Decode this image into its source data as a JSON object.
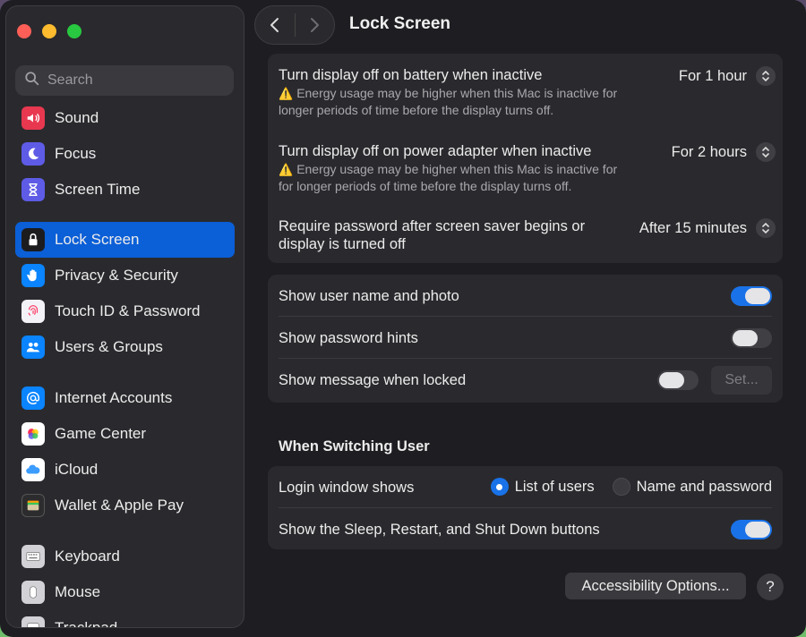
{
  "window": {
    "title": "Lock Screen"
  },
  "search": {
    "placeholder": "Search"
  },
  "sidebar": {
    "items": [
      {
        "label": "Sound",
        "icon": "speaker-icon",
        "color": "#e8384f"
      },
      {
        "label": "Focus",
        "icon": "moon-icon",
        "color": "#5e5ce6"
      },
      {
        "label": "Screen Time",
        "icon": "hourglass-icon",
        "color": "#5e5ce6"
      },
      {
        "label": "Lock Screen",
        "icon": "lock-icon",
        "color": "#1c1c1e",
        "active": true
      },
      {
        "label": "Privacy & Security",
        "icon": "hand-icon",
        "color": "#0a84ff"
      },
      {
        "label": "Touch ID & Password",
        "icon": "fingerprint-icon",
        "color": "#f2f2f7"
      },
      {
        "label": "Users & Groups",
        "icon": "users-icon",
        "color": "#0a84ff"
      },
      {
        "label": "Internet Accounts",
        "icon": "at-icon",
        "color": "#0a84ff"
      },
      {
        "label": "Game Center",
        "icon": "game-center-icon",
        "color": "#ffffff"
      },
      {
        "label": "iCloud",
        "icon": "cloud-icon",
        "color": "#ffffff"
      },
      {
        "label": "Wallet & Apple Pay",
        "icon": "wallet-icon",
        "color": "#2c2c2e"
      },
      {
        "label": "Keyboard",
        "icon": "keyboard-icon",
        "color": "#d1d1d6"
      },
      {
        "label": "Mouse",
        "icon": "mouse-icon",
        "color": "#d1d1d6"
      },
      {
        "label": "Trackpad",
        "icon": "trackpad-icon",
        "color": "#d1d1d6"
      }
    ]
  },
  "display": {
    "battery": {
      "title": "Turn display off on battery when inactive",
      "warning": "Energy usage may be higher when this Mac is inactive for",
      "warning2": "longer periods of time before the display turns off.",
      "value": "For 1 hour"
    },
    "adapter": {
      "title": "Turn display off on power adapter when inactive",
      "warning": "Energy usage may be higher when this Mac is inactive for",
      "warning2": "for longer periods of time before the display turns off.",
      "value": "For 2 hours"
    },
    "password": {
      "title": "Require password after screen saver begins or",
      "title2": "display is turned off",
      "value": "After 15 minutes"
    }
  },
  "options": {
    "show_user": {
      "label": "Show user name and photo",
      "on": true
    },
    "show_hints": {
      "label": "Show password hints",
      "on": false
    },
    "show_message": {
      "label": "Show message when locked",
      "on": false,
      "button": "Set..."
    }
  },
  "switching": {
    "header": "When Switching User",
    "login_label": "Login window shows",
    "radio_list": "List of users",
    "radio_name": "Name and password",
    "selected": "List of users",
    "sleep_label": "Show the Sleep, Restart, and Shut Down buttons",
    "sleep_on": true
  },
  "footer": {
    "accessibility": "Accessibility Options...",
    "help": "?"
  },
  "colors": {
    "accent": "#1a72e8",
    "active_sidebar": "#0b5fd7"
  }
}
